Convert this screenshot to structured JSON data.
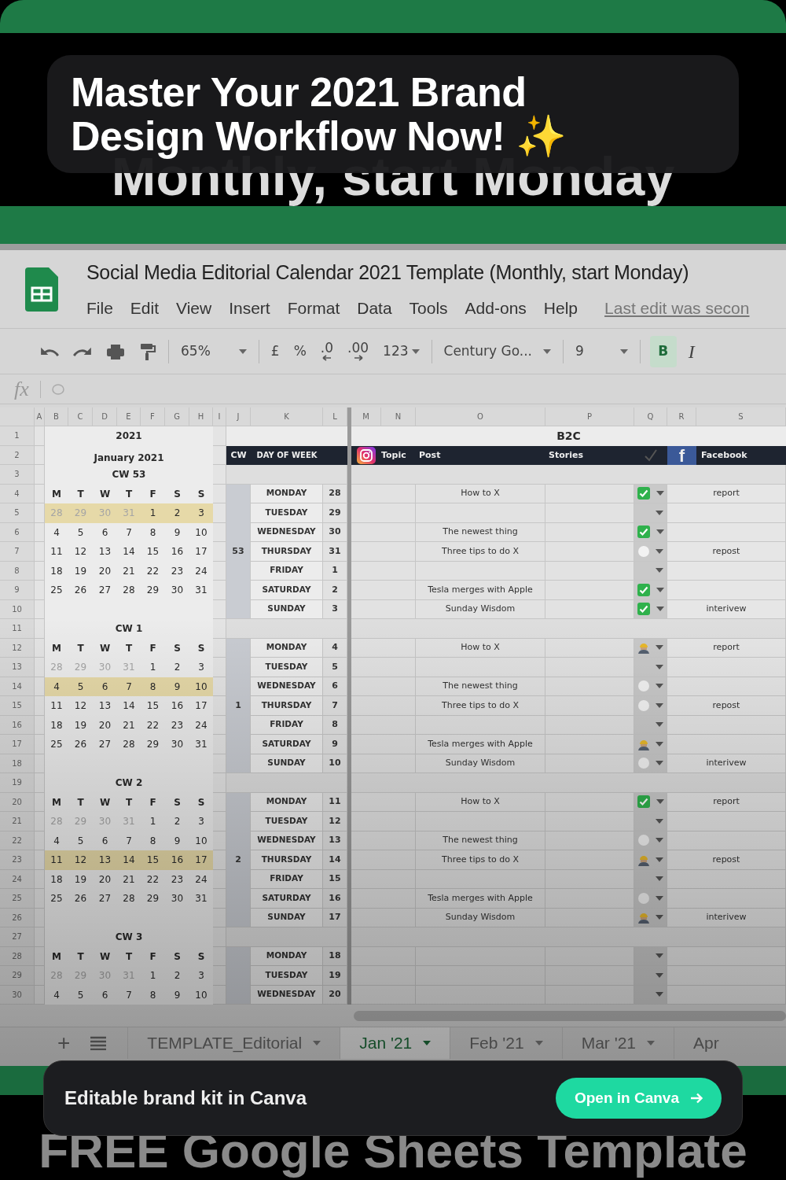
{
  "hero": {
    "bottom_text": "Monthly, start Monday",
    "footer_text": "FREE Google Sheets Template"
  },
  "banner": {
    "title": "Master Your 2021 Brand Design Workflow Now!",
    "sparkle": "✨"
  },
  "app": {
    "title": "Social Media Editorial Calendar 2021 Template (Monthly, start Monday)",
    "menu": [
      "File",
      "Edit",
      "View",
      "Insert",
      "Format",
      "Data",
      "Tools",
      "Add-ons",
      "Help"
    ],
    "last_edit": "Last edit was secon",
    "toolbar": {
      "zoom": "65%",
      "currency": "£",
      "percent": "%",
      "decrease_decimals": ".0",
      "increase_decimals": ".00",
      "number_format": "123",
      "font": "Century Go...",
      "font_size": "9",
      "bold": "B",
      "bold_active": true,
      "italic": "I"
    },
    "formula_bar": {
      "fx": "fx"
    }
  },
  "sheet": {
    "columns": [
      "A",
      "B",
      "C",
      "D",
      "E",
      "F",
      "G",
      "H",
      "I",
      "J",
      "K",
      "L",
      "M",
      "N",
      "O",
      "P",
      "Q",
      "R",
      "S"
    ],
    "rows": [
      "1",
      "2",
      "3",
      "4",
      "5",
      "6",
      "7",
      "8",
      "9",
      "10",
      "11",
      "12",
      "13",
      "14",
      "15",
      "16",
      "17",
      "18",
      "19",
      "20",
      "21",
      "22",
      "23",
      "24",
      "25",
      "26",
      "27",
      "28",
      "29",
      "30"
    ]
  },
  "calendar": {
    "year": "2021",
    "month": "January 2021",
    "blocks": [
      {
        "title": "CW 53",
        "weekdays": [
          "M",
          "T",
          "W",
          "T",
          "F",
          "S",
          "S"
        ],
        "weeks": [
          {
            "selected": true,
            "days": [
              {
                "n": "28",
                "muted": true
              },
              {
                "n": "29",
                "muted": true
              },
              {
                "n": "30",
                "muted": true
              },
              {
                "n": "31",
                "muted": true
              },
              {
                "n": "1",
                "muted": false
              },
              {
                "n": "2",
                "muted": false
              },
              {
                "n": "3",
                "muted": false
              }
            ]
          },
          {
            "selected": false,
            "days": [
              {
                "n": "4",
                "muted": false
              },
              {
                "n": "5",
                "muted": false
              },
              {
                "n": "6",
                "muted": false
              },
              {
                "n": "7",
                "muted": false
              },
              {
                "n": "8",
                "muted": false
              },
              {
                "n": "9",
                "muted": false
              },
              {
                "n": "10",
                "muted": false
              }
            ]
          },
          {
            "selected": false,
            "days": [
              {
                "n": "11",
                "muted": false
              },
              {
                "n": "12",
                "muted": false
              },
              {
                "n": "13",
                "muted": false
              },
              {
                "n": "14",
                "muted": false
              },
              {
                "n": "15",
                "muted": false
              },
              {
                "n": "16",
                "muted": false
              },
              {
                "n": "17",
                "muted": false
              }
            ]
          },
          {
            "selected": false,
            "days": [
              {
                "n": "18",
                "muted": false
              },
              {
                "n": "19",
                "muted": false
              },
              {
                "n": "20",
                "muted": false
              },
              {
                "n": "21",
                "muted": false
              },
              {
                "n": "22",
                "muted": false
              },
              {
                "n": "23",
                "muted": false
              },
              {
                "n": "24",
                "muted": false
              }
            ]
          },
          {
            "selected": false,
            "days": [
              {
                "n": "25",
                "muted": false
              },
              {
                "n": "26",
                "muted": false
              },
              {
                "n": "27",
                "muted": false
              },
              {
                "n": "28",
                "muted": false
              },
              {
                "n": "29",
                "muted": false
              },
              {
                "n": "30",
                "muted": false
              },
              {
                "n": "31",
                "muted": false
              }
            ]
          }
        ]
      },
      {
        "title": "CW 1",
        "weekdays": [
          "M",
          "T",
          "W",
          "T",
          "F",
          "S",
          "S"
        ],
        "weeks": [
          {
            "selected": false,
            "days": [
              {
                "n": "28",
                "muted": true
              },
              {
                "n": "29",
                "muted": true
              },
              {
                "n": "30",
                "muted": true
              },
              {
                "n": "31",
                "muted": true
              },
              {
                "n": "1",
                "muted": false
              },
              {
                "n": "2",
                "muted": false
              },
              {
                "n": "3",
                "muted": false
              }
            ]
          },
          {
            "selected": true,
            "days": [
              {
                "n": "4",
                "muted": false
              },
              {
                "n": "5",
                "muted": false
              },
              {
                "n": "6",
                "muted": false
              },
              {
                "n": "7",
                "muted": false
              },
              {
                "n": "8",
                "muted": false
              },
              {
                "n": "9",
                "muted": false
              },
              {
                "n": "10",
                "muted": false
              }
            ]
          },
          {
            "selected": false,
            "days": [
              {
                "n": "11",
                "muted": false
              },
              {
                "n": "12",
                "muted": false
              },
              {
                "n": "13",
                "muted": false
              },
              {
                "n": "14",
                "muted": false
              },
              {
                "n": "15",
                "muted": false
              },
              {
                "n": "16",
                "muted": false
              },
              {
                "n": "17",
                "muted": false
              }
            ]
          },
          {
            "selected": false,
            "days": [
              {
                "n": "18",
                "muted": false
              },
              {
                "n": "19",
                "muted": false
              },
              {
                "n": "20",
                "muted": false
              },
              {
                "n": "21",
                "muted": false
              },
              {
                "n": "22",
                "muted": false
              },
              {
                "n": "23",
                "muted": false
              },
              {
                "n": "24",
                "muted": false
              }
            ]
          },
          {
            "selected": false,
            "days": [
              {
                "n": "25",
                "muted": false
              },
              {
                "n": "26",
                "muted": false
              },
              {
                "n": "27",
                "muted": false
              },
              {
                "n": "28",
                "muted": false
              },
              {
                "n": "29",
                "muted": false
              },
              {
                "n": "30",
                "muted": false
              },
              {
                "n": "31",
                "muted": false
              }
            ]
          }
        ]
      },
      {
        "title": "CW 2",
        "weekdays": [
          "M",
          "T",
          "W",
          "T",
          "F",
          "S",
          "S"
        ],
        "weeks": [
          {
            "selected": false,
            "days": [
              {
                "n": "28",
                "muted": true
              },
              {
                "n": "29",
                "muted": true
              },
              {
                "n": "30",
                "muted": true
              },
              {
                "n": "31",
                "muted": true
              },
              {
                "n": "1",
                "muted": false
              },
              {
                "n": "2",
                "muted": false
              },
              {
                "n": "3",
                "muted": false
              }
            ]
          },
          {
            "selected": false,
            "days": [
              {
                "n": "4",
                "muted": false
              },
              {
                "n": "5",
                "muted": false
              },
              {
                "n": "6",
                "muted": false
              },
              {
                "n": "7",
                "muted": false
              },
              {
                "n": "8",
                "muted": false
              },
              {
                "n": "9",
                "muted": false
              },
              {
                "n": "10",
                "muted": false
              }
            ]
          },
          {
            "selected": true,
            "days": [
              {
                "n": "11",
                "muted": false
              },
              {
                "n": "12",
                "muted": false
              },
              {
                "n": "13",
                "muted": false
              },
              {
                "n": "14",
                "muted": false
              },
              {
                "n": "15",
                "muted": false
              },
              {
                "n": "16",
                "muted": false
              },
              {
                "n": "17",
                "muted": false
              }
            ]
          },
          {
            "selected": false,
            "days": [
              {
                "n": "18",
                "muted": false
              },
              {
                "n": "19",
                "muted": false
              },
              {
                "n": "20",
                "muted": false
              },
              {
                "n": "21",
                "muted": false
              },
              {
                "n": "22",
                "muted": false
              },
              {
                "n": "23",
                "muted": false
              },
              {
                "n": "24",
                "muted": false
              }
            ]
          },
          {
            "selected": false,
            "days": [
              {
                "n": "25",
                "muted": false
              },
              {
                "n": "26",
                "muted": false
              },
              {
                "n": "27",
                "muted": false
              },
              {
                "n": "28",
                "muted": false
              },
              {
                "n": "29",
                "muted": false
              },
              {
                "n": "30",
                "muted": false
              },
              {
                "n": "31",
                "muted": false
              }
            ]
          }
        ]
      },
      {
        "title": "CW 3",
        "weekdays": [
          "M",
          "T",
          "W",
          "T",
          "F",
          "S",
          "S"
        ],
        "weeks": [
          {
            "selected": false,
            "days": [
              {
                "n": "28",
                "muted": true
              },
              {
                "n": "29",
                "muted": true
              },
              {
                "n": "30",
                "muted": true
              },
              {
                "n": "31",
                "muted": true
              },
              {
                "n": "1",
                "muted": false
              },
              {
                "n": "2",
                "muted": false
              },
              {
                "n": "3",
                "muted": false
              }
            ]
          },
          {
            "selected": false,
            "days": [
              {
                "n": "4",
                "muted": false
              },
              {
                "n": "5",
                "muted": false
              },
              {
                "n": "6",
                "muted": false
              },
              {
                "n": "7",
                "muted": false
              },
              {
                "n": "8",
                "muted": false
              },
              {
                "n": "9",
                "muted": false
              },
              {
                "n": "10",
                "muted": false
              }
            ]
          }
        ]
      }
    ]
  },
  "plan": {
    "cw_header": "CW",
    "day_header": "DAY OF WEEK",
    "section": "B2C",
    "topic_header": "Topic",
    "post_header": "Post",
    "stories_header": "Stories",
    "facebook_logo": "f",
    "facebook_header": "Facebook",
    "groups": [
      {
        "cw": "53",
        "days": [
          {
            "day": "MONDAY",
            "date": "28",
            "post": "How to X",
            "kind": "done",
            "facebook": "report"
          },
          {
            "day": "TUESDAY",
            "date": "29",
            "kind": "none"
          },
          {
            "day": "WEDNESDAY",
            "date": "30",
            "post": "The newest thing",
            "kind": "done"
          },
          {
            "day": "THURSDAY",
            "date": "31",
            "post": "Three tips to do X",
            "kind": "pending",
            "facebook": "repost"
          },
          {
            "day": "FRIDAY",
            "date": "1",
            "kind": "none"
          },
          {
            "day": "SATURDAY",
            "date": "2",
            "post": "Tesla merges with Apple",
            "kind": "done"
          },
          {
            "day": "SUNDAY",
            "date": "3",
            "post": "Sunday Wisdom",
            "kind": "done",
            "facebook": "interivew"
          }
        ]
      },
      {
        "cw": "1",
        "days": [
          {
            "day": "MONDAY",
            "date": "4",
            "post": "How to X",
            "kind": "working",
            "facebook": "report"
          },
          {
            "day": "TUESDAY",
            "date": "5",
            "kind": "none"
          },
          {
            "day": "WEDNESDAY",
            "date": "6",
            "post": "The newest thing",
            "kind": "pending"
          },
          {
            "day": "THURSDAY",
            "date": "7",
            "post": "Three tips to do X",
            "kind": "pending",
            "facebook": "repost"
          },
          {
            "day": "FRIDAY",
            "date": "8",
            "kind": "none"
          },
          {
            "day": "SATURDAY",
            "date": "9",
            "post": "Tesla merges with Apple",
            "kind": "working"
          },
          {
            "day": "SUNDAY",
            "date": "10",
            "post": "Sunday Wisdom",
            "kind": "pending",
            "facebook": "interivew"
          }
        ]
      },
      {
        "cw": "2",
        "days": [
          {
            "day": "MONDAY",
            "date": "11",
            "post": "How to X",
            "kind": "done",
            "facebook": "report"
          },
          {
            "day": "TUESDAY",
            "date": "12",
            "kind": "none"
          },
          {
            "day": "WEDNESDAY",
            "date": "13",
            "post": "The newest thing",
            "kind": "pending"
          },
          {
            "day": "THURSDAY",
            "date": "14",
            "post": "Three tips to do X",
            "kind": "working",
            "facebook": "repost"
          },
          {
            "day": "FRIDAY",
            "date": "15",
            "kind": "none"
          },
          {
            "day": "SATURDAY",
            "date": "16",
            "post": "Tesla merges with Apple",
            "kind": "pending"
          },
          {
            "day": "SUNDAY",
            "date": "17",
            "post": "Sunday Wisdom",
            "kind": "working",
            "facebook": "interivew"
          }
        ]
      },
      {
        "days": [
          {
            "day": "MONDAY",
            "date": "18",
            "kind": "none"
          },
          {
            "day": "TUESDAY",
            "date": "19",
            "kind": "none"
          },
          {
            "day": "WEDNESDAY",
            "date": "20",
            "kind": "none"
          }
        ]
      }
    ]
  },
  "sheet_tabs": {
    "add": "+",
    "tabs": [
      {
        "label": "TEMPLATE_Editorial",
        "selected": false,
        "caret": true
      },
      {
        "label": "Jan '21",
        "selected": true,
        "caret": true
      },
      {
        "label": "Feb '21",
        "selected": false,
        "caret": true
      },
      {
        "label": "Mar '21",
        "selected": false,
        "caret": true
      },
      {
        "label": "Apr",
        "selected": false,
        "caret": false
      }
    ]
  },
  "footer_card": {
    "text": "Editable brand kit in Canva",
    "button": "Open in Canva"
  }
}
